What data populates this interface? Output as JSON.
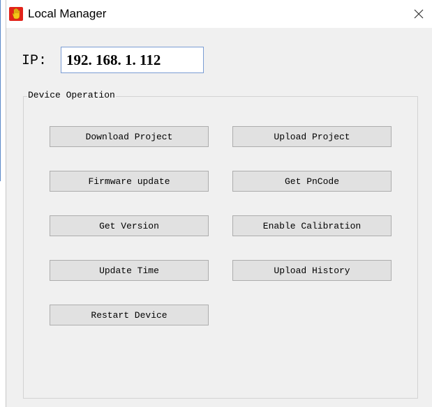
{
  "window": {
    "title": "Local Manager",
    "close_icon": "close-icon",
    "app_icon": "hand-app-icon"
  },
  "ip": {
    "label": "IP:",
    "value": "192. 168. 1. 112"
  },
  "device_operation": {
    "legend": "Device Operation",
    "buttons": {
      "download_project": "Download Project",
      "upload_project": "Upload Project",
      "firmware_update": "Firmware update",
      "get_pncode": "Get PnCode",
      "get_version": "Get Version",
      "enable_calibration": "Enable Calibration",
      "update_time": "Update Time",
      "upload_history": "Upload History",
      "restart_device": "Restart Device"
    }
  },
  "colors": {
    "window_bg": "#f0f0f0",
    "titlebar_bg": "#ffffff",
    "button_bg": "#e1e1e1",
    "button_border": "#adadad",
    "input_border": "#7a9cd3",
    "icon_red": "#e2231a",
    "icon_yellow": "#f5c518"
  }
}
